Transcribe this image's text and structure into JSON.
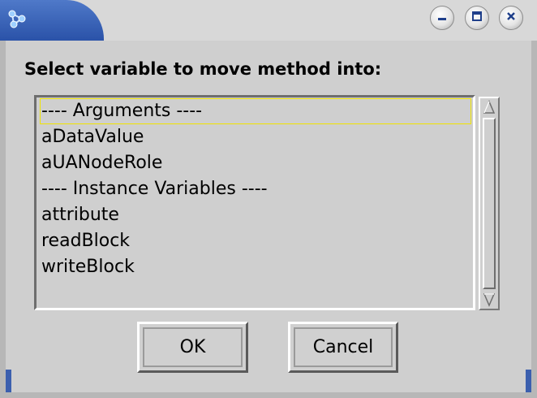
{
  "window": {
    "app_icon": "molecule-icon",
    "controls": {
      "minimize_icon": "minimize-icon",
      "maximize_icon": "maximize-icon",
      "close_icon": "close-icon"
    }
  },
  "dialog": {
    "prompt": "Select variable to move method into:",
    "list": {
      "items": [
        "---- Arguments ----",
        "aDataValue",
        "aUANodeRole",
        "---- Instance Variables ----",
        "attribute",
        "readBlock",
        "writeBlock"
      ],
      "selected_index": 0
    },
    "buttons": {
      "ok": "OK",
      "cancel": "Cancel"
    }
  },
  "colors": {
    "titlebar_accent": "#2f58ad",
    "dialog_background": "#cfcfcf",
    "selection_outline": "#f0e400"
  }
}
